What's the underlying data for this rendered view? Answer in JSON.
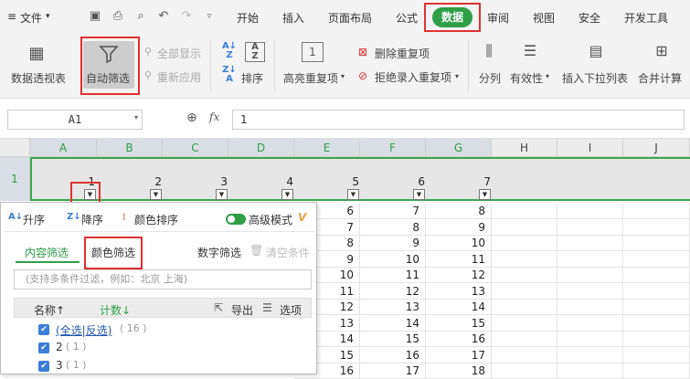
{
  "menu": {
    "file": "文件",
    "tabs": [
      "开始",
      "插入",
      "页面布局",
      "公式",
      "数据",
      "审阅",
      "视图",
      "安全",
      "开发工具"
    ],
    "active_tab": "数据"
  },
  "ribbon": {
    "pivot": "数据透视表",
    "autofilter": "自动筛选",
    "show_all": "全部显示",
    "reapply": "重新应用",
    "sort": "排序",
    "highlight_dup": "高亮重复项",
    "remove_dup": "删除重复项",
    "reject_dup": "拒绝录入重复项",
    "split": "分列",
    "validity": "有效性",
    "insert_dropdown": "插入下拉列表",
    "merge_calc": "合并计算"
  },
  "formula_bar": {
    "cell_ref": "A1",
    "fx": "fx",
    "value": "1"
  },
  "columns": [
    "A",
    "B",
    "C",
    "D",
    "E",
    "F",
    "G",
    "H",
    "I",
    "J"
  ],
  "row1": {
    "number": "1",
    "values": [
      "1",
      "2",
      "3",
      "4",
      "5",
      "6",
      "7"
    ]
  },
  "grid_rows": [
    [
      "6",
      "7",
      "8"
    ],
    [
      "7",
      "8",
      "9"
    ],
    [
      "8",
      "9",
      "10"
    ],
    [
      "9",
      "10",
      "11"
    ],
    [
      "10",
      "11",
      "12"
    ],
    [
      "11",
      "12",
      "13"
    ],
    [
      "12",
      "13",
      "14"
    ],
    [
      "13",
      "14",
      "15"
    ],
    [
      "14",
      "15",
      "16"
    ],
    [
      "15",
      "16",
      "17"
    ],
    [
      "16",
      "17",
      "18"
    ]
  ],
  "filter_panel": {
    "asc": "升序",
    "desc": "降序",
    "color_sort": "颜色排序",
    "advanced": "高级模式",
    "tab_content": "内容筛选",
    "tab_color": "颜色筛选",
    "tab_number": "数字筛选",
    "clear": "清空条件",
    "search_placeholder": "(支持多条件过滤，例如：北京 上海)",
    "col_name": "名称↑",
    "col_count": "计数↓",
    "export": "导出",
    "options": "选项",
    "select_all": "(全选|反选)",
    "select_all_count": "( 16 )",
    "items": [
      {
        "label": "2",
        "count": "( 1 )"
      },
      {
        "label": "3",
        "count": "( 1 )"
      }
    ]
  },
  "colors": {
    "accent": "#2e9e47",
    "highlight": "#e03131"
  }
}
